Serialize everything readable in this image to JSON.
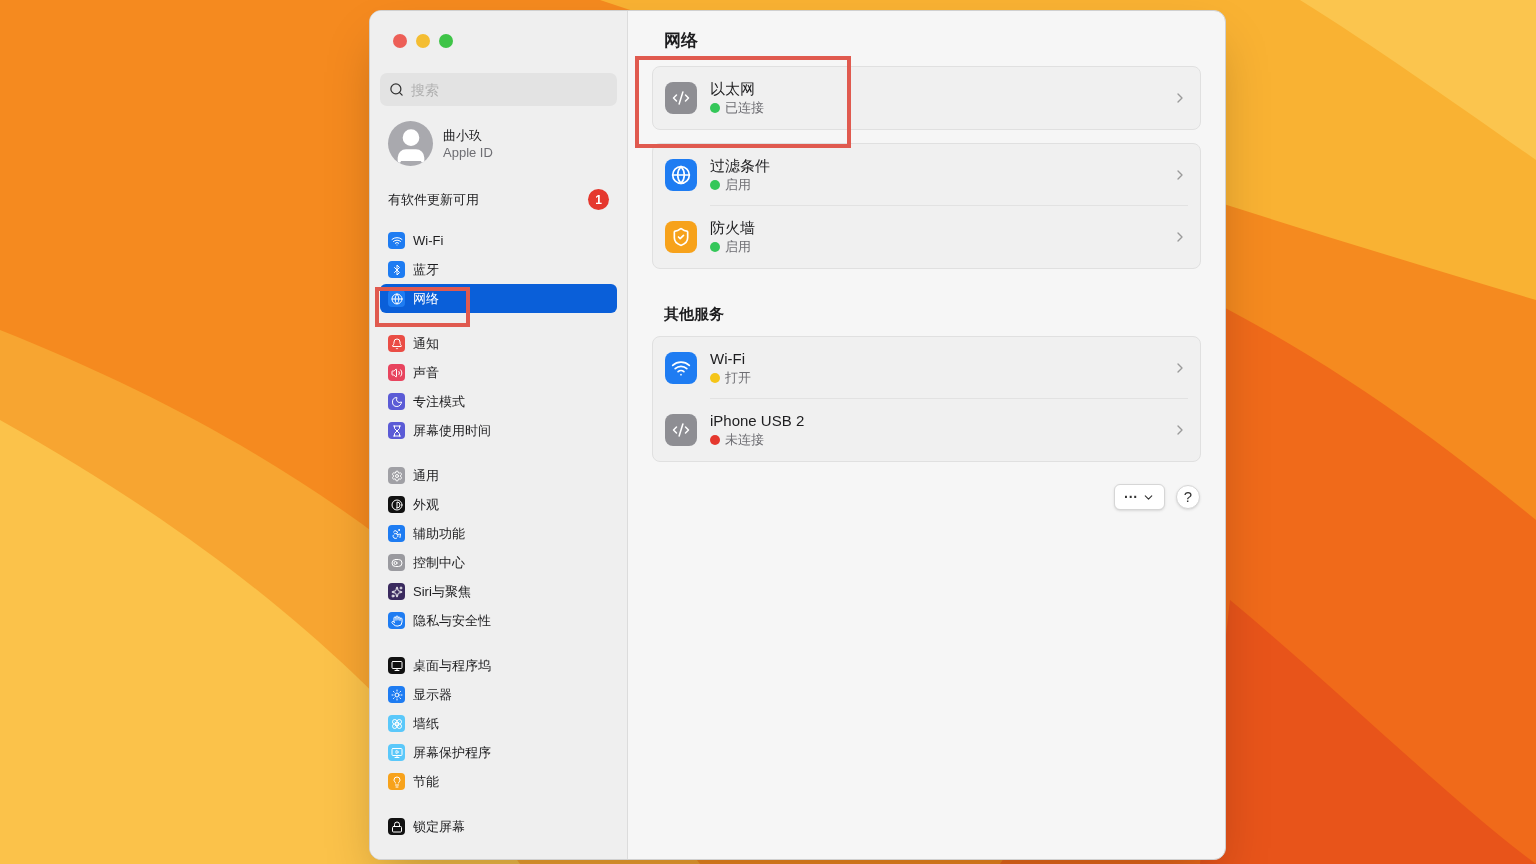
{
  "sidebar": {
    "search": {
      "placeholder": "搜索"
    },
    "account": {
      "name": "曲小玖",
      "subtitle": "Apple ID"
    },
    "update": {
      "label": "有软件更新可用",
      "badge": "1"
    },
    "groups": [
      [
        {
          "label": "Wi-Fi",
          "selected": false
        },
        {
          "label": "蓝牙",
          "selected": false
        },
        {
          "label": "网络",
          "selected": true
        }
      ],
      [
        {
          "label": "通知",
          "selected": false
        },
        {
          "label": "声音",
          "selected": false
        },
        {
          "label": "专注模式",
          "selected": false
        },
        {
          "label": "屏幕使用时间",
          "selected": false
        }
      ],
      [
        {
          "label": "通用",
          "selected": false
        },
        {
          "label": "外观",
          "selected": false
        },
        {
          "label": "辅助功能",
          "selected": false
        },
        {
          "label": "控制中心",
          "selected": false
        },
        {
          "label": "Siri与聚焦",
          "selected": false
        },
        {
          "label": "隐私与安全性",
          "selected": false
        }
      ],
      [
        {
          "label": "桌面与程序坞",
          "selected": false
        },
        {
          "label": "显示器",
          "selected": false
        },
        {
          "label": "墙纸",
          "selected": false
        },
        {
          "label": "屏幕保护程序",
          "selected": false
        },
        {
          "label": "节能",
          "selected": false
        }
      ],
      [
        {
          "label": "锁定屏幕",
          "selected": false
        }
      ]
    ]
  },
  "main": {
    "title": "网络",
    "cards": [
      [
        {
          "name": "以太网",
          "status": "已连接",
          "color": "#34c759"
        }
      ],
      [
        {
          "name": "过滤条件",
          "status": "启用",
          "color": "#34c759"
        },
        {
          "name": "防火墙",
          "status": "启用",
          "color": "#34c759"
        }
      ]
    ],
    "other_title": "其他服务",
    "other_cards": [
      [
        {
          "name": "Wi-Fi",
          "status": "打开",
          "color": "#f5c518"
        },
        {
          "name": "iPhone USB 2",
          "status": "未连接",
          "color": "#e5382e"
        }
      ]
    ],
    "more_button": "···",
    "help_button": "?"
  }
}
